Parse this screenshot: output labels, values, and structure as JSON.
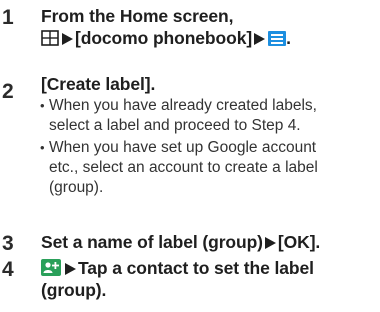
{
  "steps": [
    {
      "number": "1",
      "line1": "From the Home screen,",
      "line2_part1": "[docomo phonebook]",
      "line2_end": ".",
      "icons": [
        "apps-icon",
        "menu-icon"
      ]
    },
    {
      "number": "2",
      "title": "[Create label].",
      "bullets": [
        [
          "When you have already created labels,",
          "select a label and proceed to Step 4."
        ],
        [
          "When you have set up Google account",
          "etc., select an account to create a label",
          "(group)."
        ]
      ]
    },
    {
      "number": "3",
      "title_part1": "Set a name of label (group)",
      "title_part2": "[OK]."
    },
    {
      "number": "4",
      "line1": "Tap a contact to set the label",
      "line2": "(group).",
      "icons": [
        "label-add-icon"
      ]
    }
  ]
}
